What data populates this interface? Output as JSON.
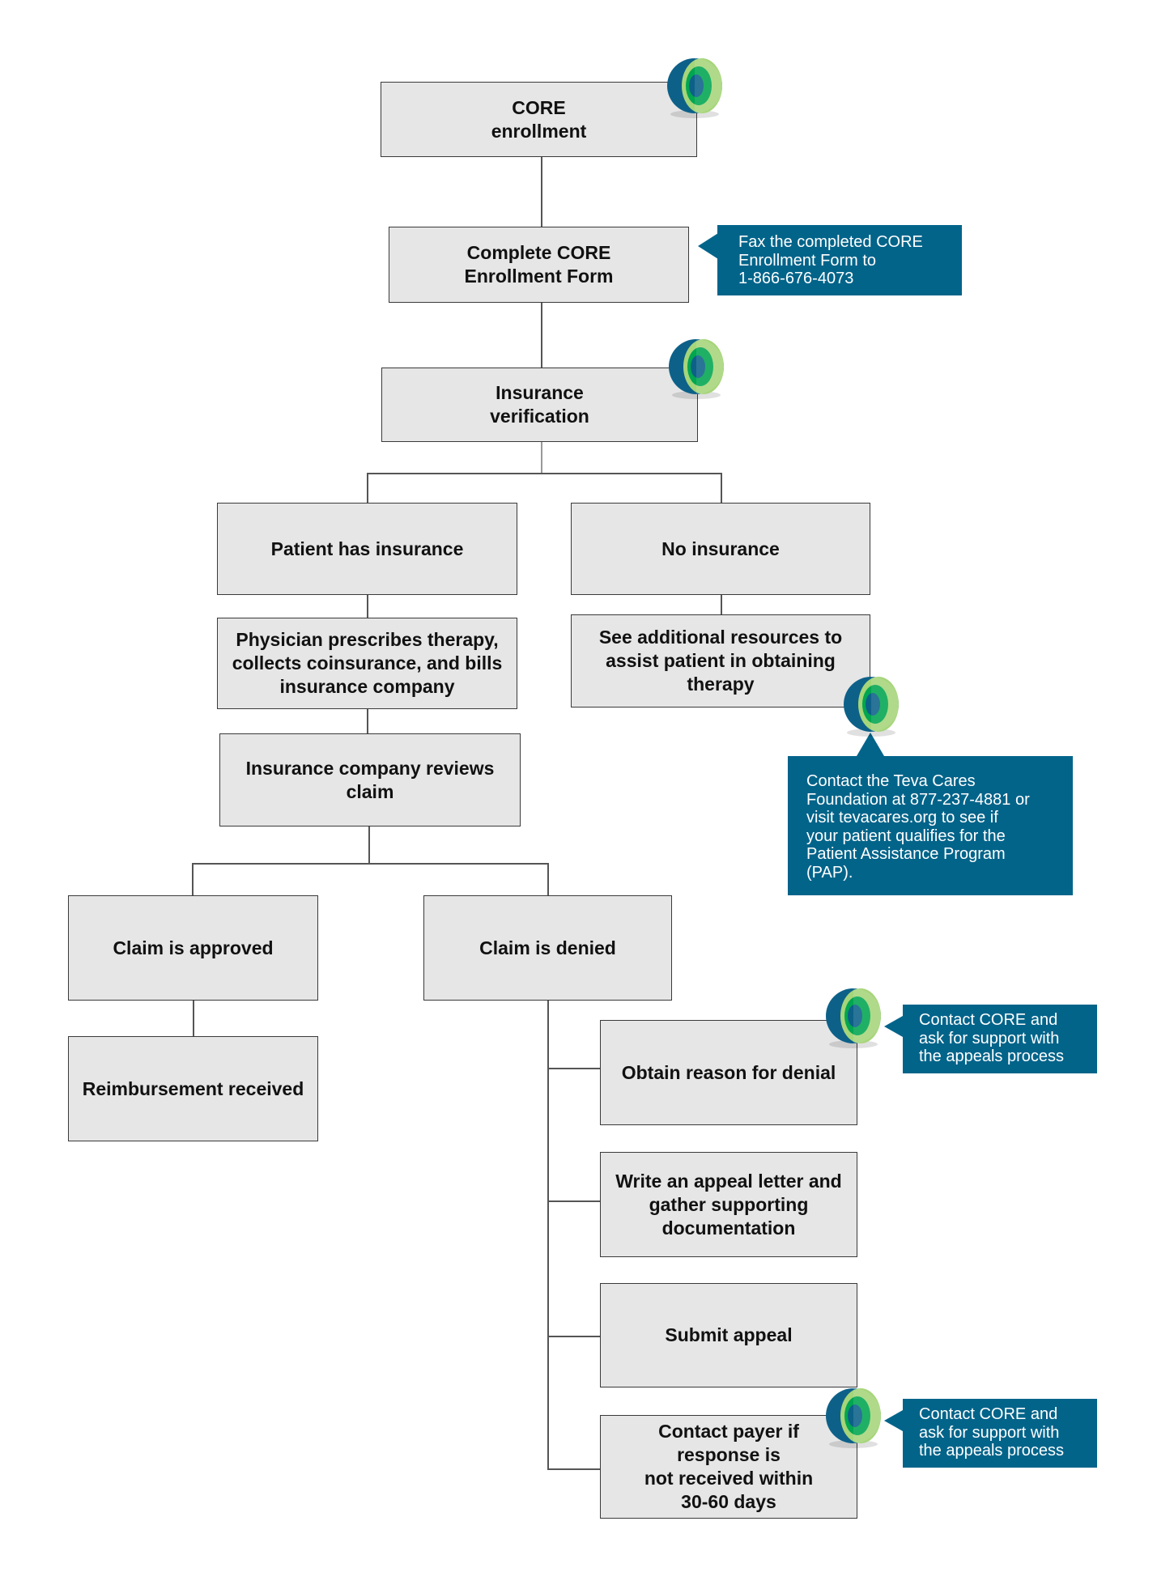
{
  "diagram": {
    "nodes": {
      "core_enrollment": "CORE\nenrollment",
      "complete_form": "Complete CORE\nEnrollment Form",
      "insurance_verification": "Insurance\nverification",
      "has_insurance": "Patient has insurance",
      "no_insurance": "No insurance",
      "physician_prescribes": "Physician prescribes therapy,\ncollects coinsurance, and bills\ninsurance company",
      "additional_resources": "See additional resources to\nassist patient in obtaining\ntherapy",
      "company_reviews": "Insurance company reviews\nclaim",
      "claim_approved": "Claim is approved",
      "claim_denied": "Claim is denied",
      "reimbursement": "Reimbursement received",
      "obtain_reason": "Obtain reason for denial",
      "write_appeal": "Write an appeal letter and\ngather supporting\ndocumentation",
      "submit_appeal": "Submit appeal",
      "contact_payer": "Contact payer if\nresponse is\nnot received within\n30-60 days"
    },
    "callouts": {
      "fax": "Fax the completed CORE\nEnrollment Form to\n1-866-676-4073",
      "teva_cares": "Contact the Teva Cares\nFoundation at 877-237-4881 or\nvisit tevacares.org to see if\nyour patient qualifies for the\nPatient Assistance Program\n(PAP).",
      "appeals_support_1": "Contact CORE and\nask for support with\nthe appeals process",
      "appeals_support_2": "Contact CORE and\nask for support with\nthe appeals process"
    },
    "icons": [
      "core-logo-icon",
      "core-logo-icon",
      "core-logo-icon",
      "core-logo-icon",
      "core-logo-icon"
    ],
    "colors": {
      "callout_bg": "#03648a",
      "box_bg": "#e6e6e6",
      "logo_dark_blue": "#0d6189",
      "logo_green": "#00a650",
      "logo_light_green": "#a6d57a"
    }
  }
}
